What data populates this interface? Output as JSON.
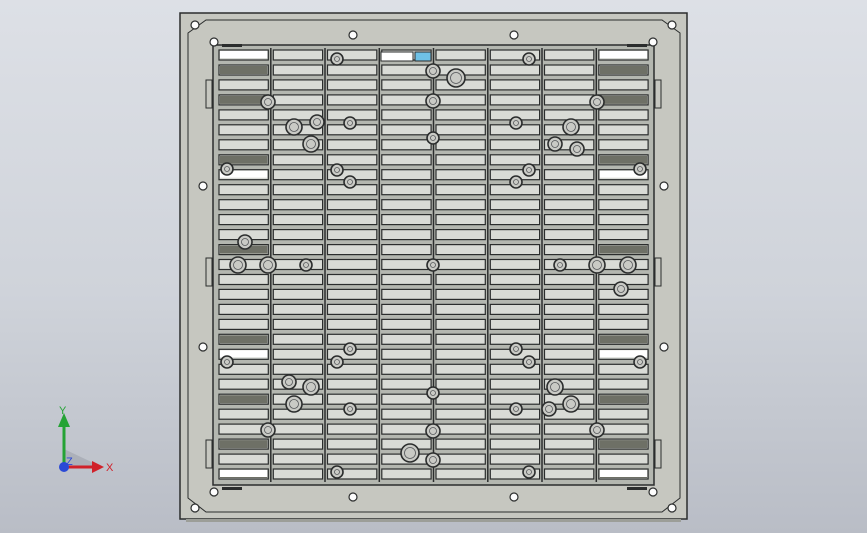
{
  "viewport": {
    "name": "graphics-area",
    "background_top": "#dde0e6",
    "background_bottom": "#b9bdc6"
  },
  "part": {
    "name": "louvered-vent-panel",
    "frame_color": "#c6c7c0",
    "inner_color": "#b4b7b0",
    "slat_color": "#d9dbd6",
    "edge_color": "#2b2d2d",
    "dark_slot_color": "#6e7066",
    "badge_color": "#6fc1e6",
    "columns": 8,
    "rows": 29
  },
  "triad": {
    "x_label": "X",
    "y_label": "Y",
    "z_label": "Z",
    "x_color": "#d0212a",
    "y_color": "#25a335",
    "z_color": "#2a49d6"
  }
}
